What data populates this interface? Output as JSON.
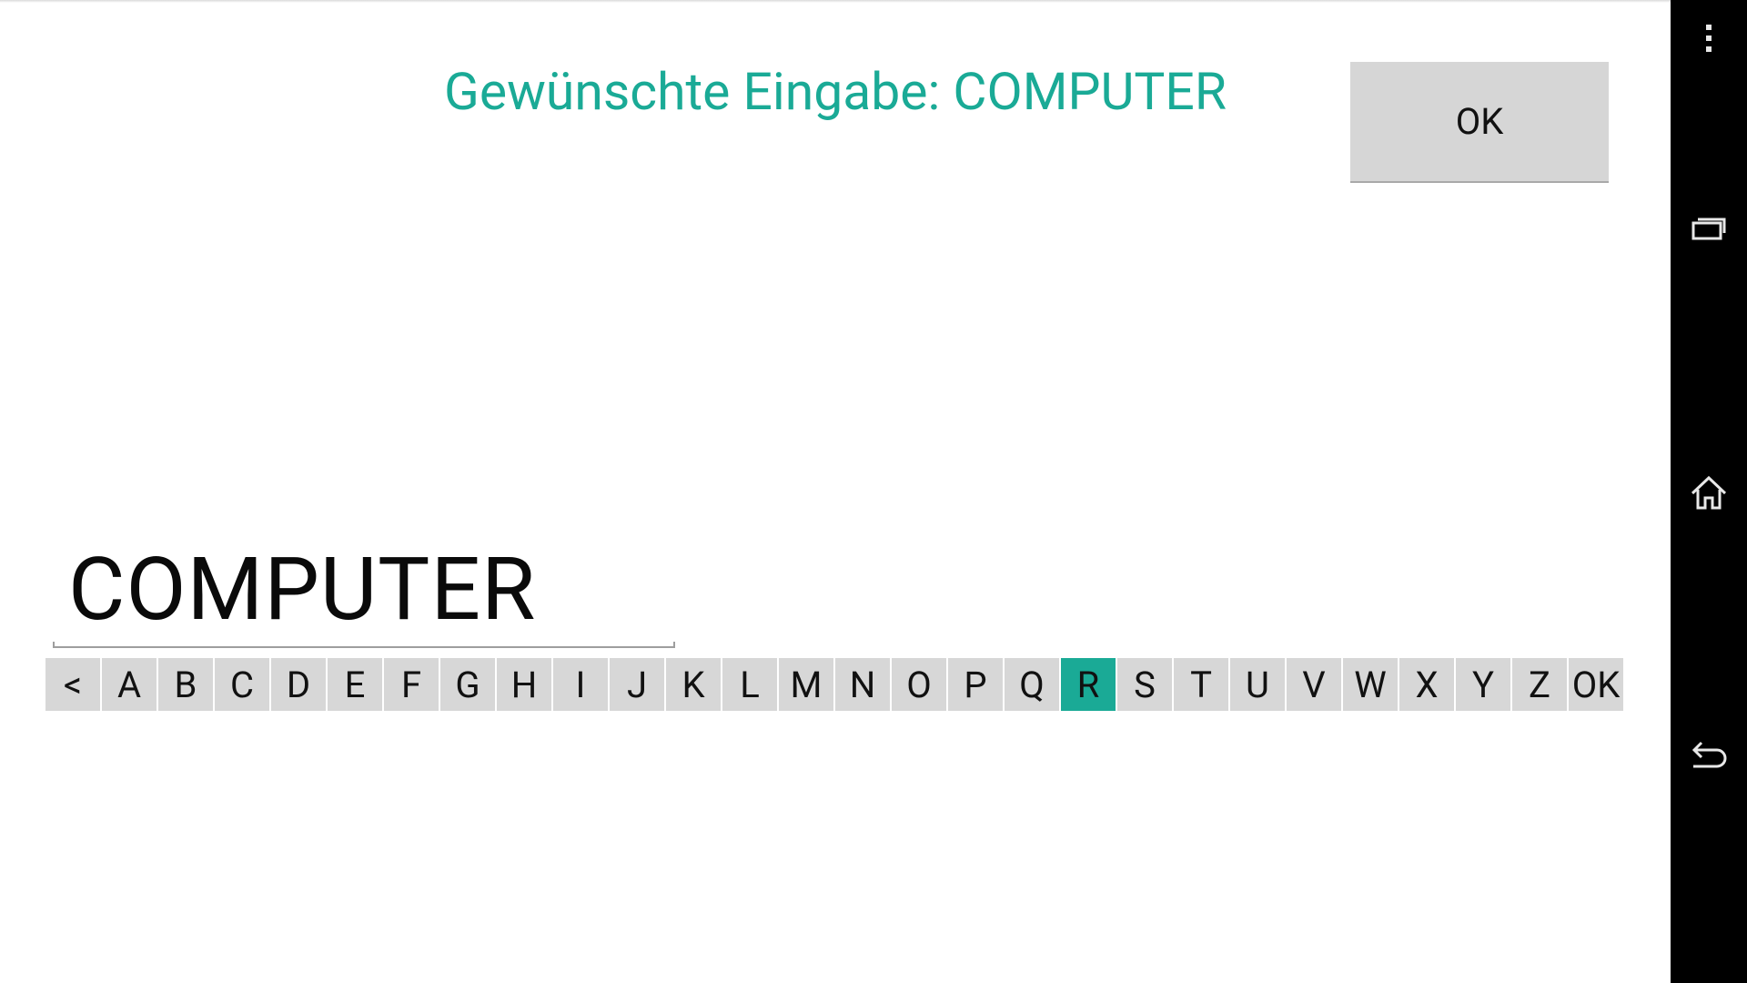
{
  "prompt": {
    "text": "Gewünschte Eingabe: COMPUTER",
    "color": "#1aaa96"
  },
  "ok_button": {
    "label": "OK"
  },
  "input": {
    "value": "COMPUTER"
  },
  "keyboard": {
    "keys": [
      "<",
      "A",
      "B",
      "C",
      "D",
      "E",
      "F",
      "G",
      "H",
      "I",
      "J",
      "K",
      "L",
      "M",
      "N",
      "O",
      "P",
      "Q",
      "R",
      "S",
      "T",
      "U",
      "V",
      "W",
      "X",
      "Y",
      "Z",
      "OK"
    ],
    "selected_key": "R",
    "key_color": "#d7d7d7",
    "selected_color": "#1aaa96"
  },
  "nav_bar": {
    "icons": [
      "overflow-menu-icon",
      "recent-apps-icon",
      "home-icon",
      "back-icon"
    ],
    "background": "#000000"
  }
}
